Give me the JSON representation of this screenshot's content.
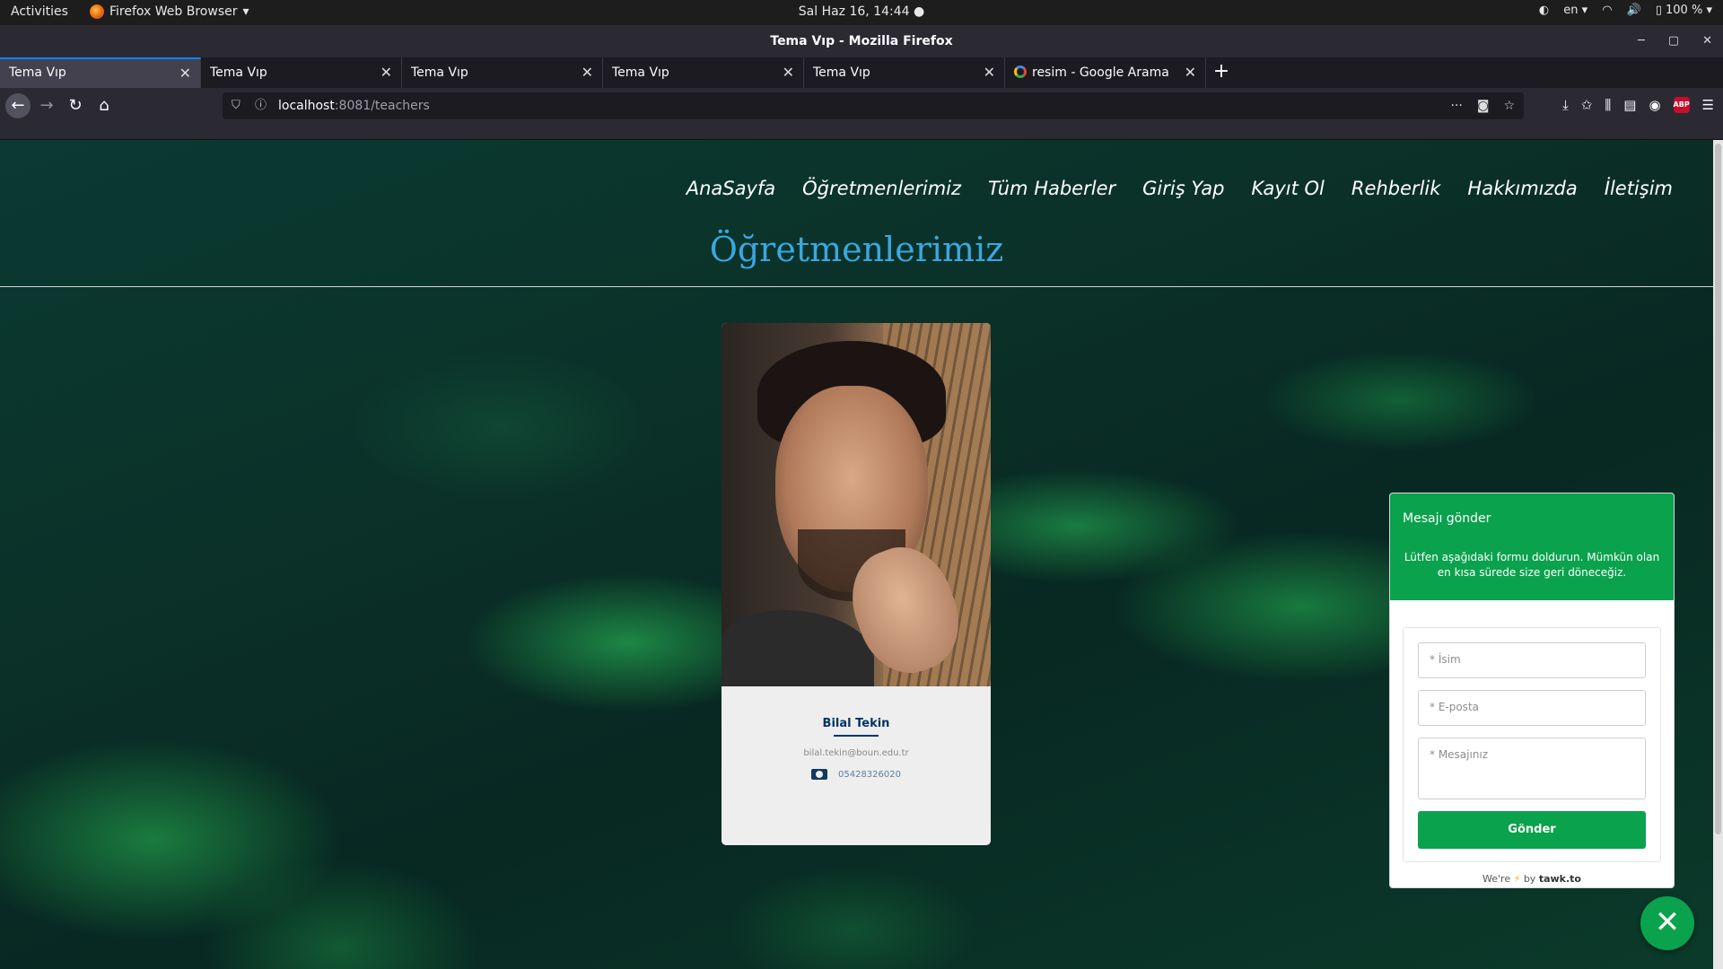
{
  "system_bar": {
    "activities": "Activities",
    "app_name": "Firefox Web Browser",
    "clock": "Sal Haz 16, 14:44",
    "language": "en",
    "battery": "100 %"
  },
  "window": {
    "title": "Tema Vıp - Mozilla Firefox"
  },
  "tabs": [
    {
      "label": "Tema Vıp",
      "active": true
    },
    {
      "label": "Tema Vıp",
      "active": false
    },
    {
      "label": "Tema Vıp",
      "active": false
    },
    {
      "label": "Tema Vıp",
      "active": false
    },
    {
      "label": "Tema Vıp",
      "active": false
    },
    {
      "label": "resim - Google Arama",
      "active": false
    }
  ],
  "url": {
    "host": "localhost",
    "rest": ":8081/teachers"
  },
  "site": {
    "menu": [
      "AnaSayfa",
      "Öğretmenlerimiz",
      "Tüm Haberler",
      "Giriş Yap",
      "Kayıt Ol",
      "Rehberlik",
      "Hakkımızda",
      "İletişim"
    ],
    "page_title": "Öğretmenlerimiz",
    "teacher": {
      "name": "Bilal Tekin",
      "email": "bilal.tekin@boun.edu.tr",
      "phone": "05428326020"
    }
  },
  "chat": {
    "header_title": "Mesajı gönder",
    "header_desc": "Lütfen aşağıdaki formu doldurun. Mümkün olan en kısa sürede size geri döneceğiz.",
    "name_placeholder": "* İsim",
    "email_placeholder": "* E-posta",
    "message_placeholder": "* Mesajınız",
    "send_label": "Gönder",
    "footer_prefix": "We're",
    "footer_by": "by",
    "footer_brand": "tawk.to",
    "close_symbol": "✕",
    "accent_color": "#0aa24d"
  }
}
